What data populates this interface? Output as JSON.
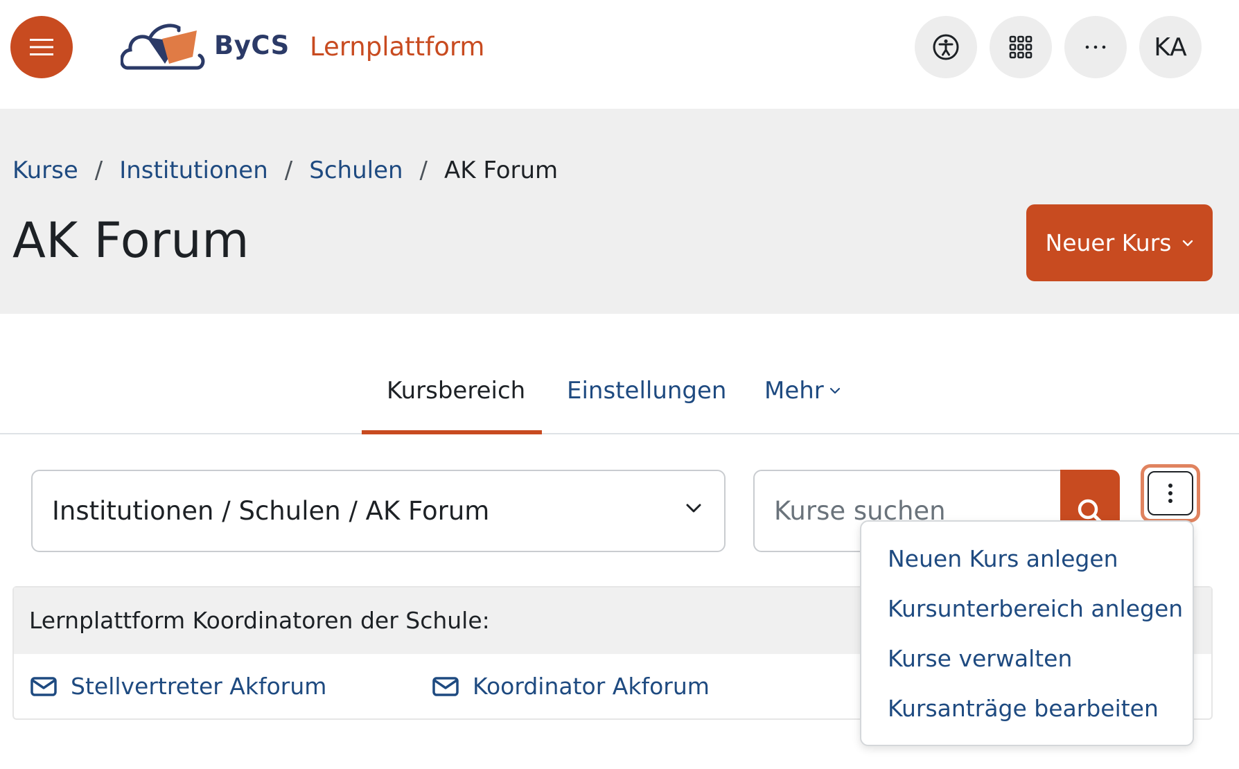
{
  "navbar": {
    "menu_icon": "hamburger-icon",
    "brand": "ByCS",
    "platform": "Lernplattform",
    "icons": [
      "accessibility-icon",
      "apps-grid-icon",
      "more-horizontal-icon"
    ],
    "avatar_initials": "KA"
  },
  "breadcrumb": {
    "items": [
      "Kurse",
      "Institutionen",
      "Schulen"
    ],
    "current": "AK Forum",
    "separator": "/"
  },
  "header": {
    "title": "AK Forum",
    "new_course_label": "Neuer Kurs"
  },
  "tabs": [
    {
      "label": "Kursbereich",
      "active": true
    },
    {
      "label": "Einstellungen",
      "active": false
    },
    {
      "label": "Mehr",
      "active": false
    }
  ],
  "filters": {
    "category_value": "Institutionen / Schulen / AK Forum",
    "search_placeholder": "Kurse suchen"
  },
  "coordinators": {
    "title": "Lernplattform Koordinatoren der Schule:",
    "contacts": [
      "Stellvertreter Akforum",
      "Koordinator Akforum"
    ]
  },
  "dropdown": {
    "items": [
      "Neuen Kurs anlegen",
      "Kursunterbereich anlegen",
      "Kurse verwalten",
      "Kursanträge bearbeiten"
    ]
  },
  "colors": {
    "accent": "#c84b20",
    "link": "#1e4a80",
    "brand_navy": "#2b3a67",
    "header_bg": "#efefef"
  }
}
